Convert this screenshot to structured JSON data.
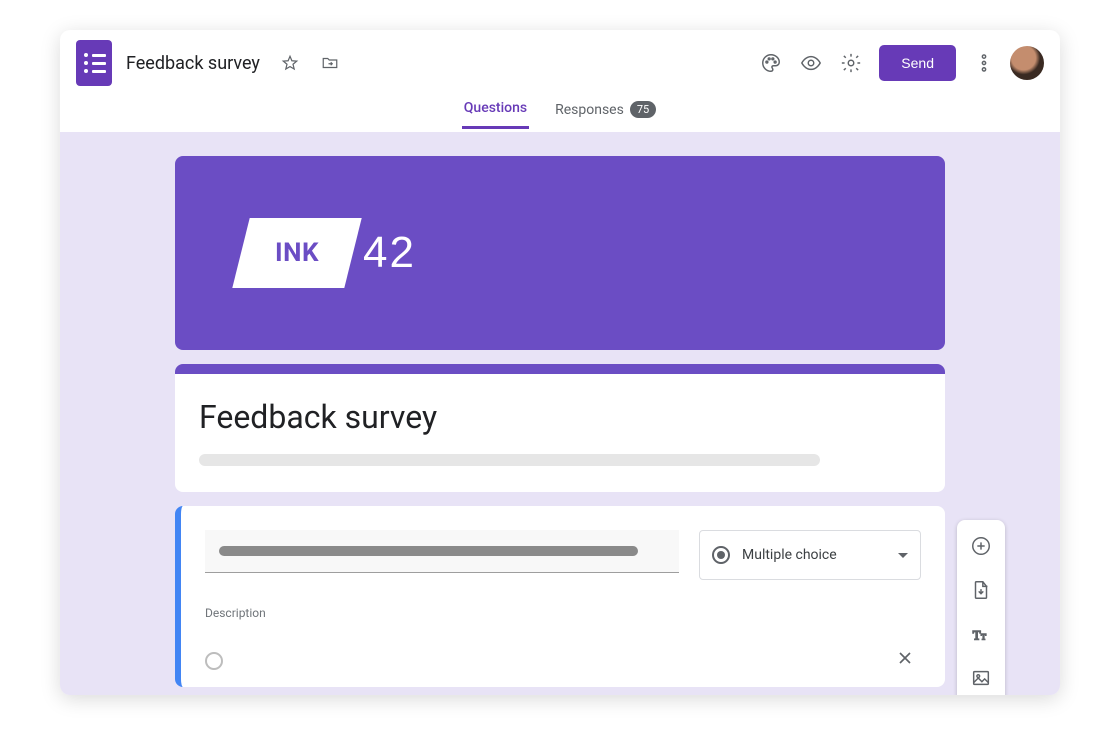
{
  "header": {
    "doc_title": "Feedback survey",
    "send_label": "Send"
  },
  "tabs": {
    "questions": "Questions",
    "responses": "Responses",
    "responses_count": "75"
  },
  "banner": {
    "logo_text": "INK",
    "logo_number": "42"
  },
  "title_card": {
    "title": "Feedback survey"
  },
  "question": {
    "type_label": "Multiple choice",
    "description_label": "Description"
  },
  "colors": {
    "accent": "#673ab7",
    "banner": "#6b4dc4",
    "canvas_bg": "#e8e3f6",
    "active_border": "#4285f4"
  }
}
